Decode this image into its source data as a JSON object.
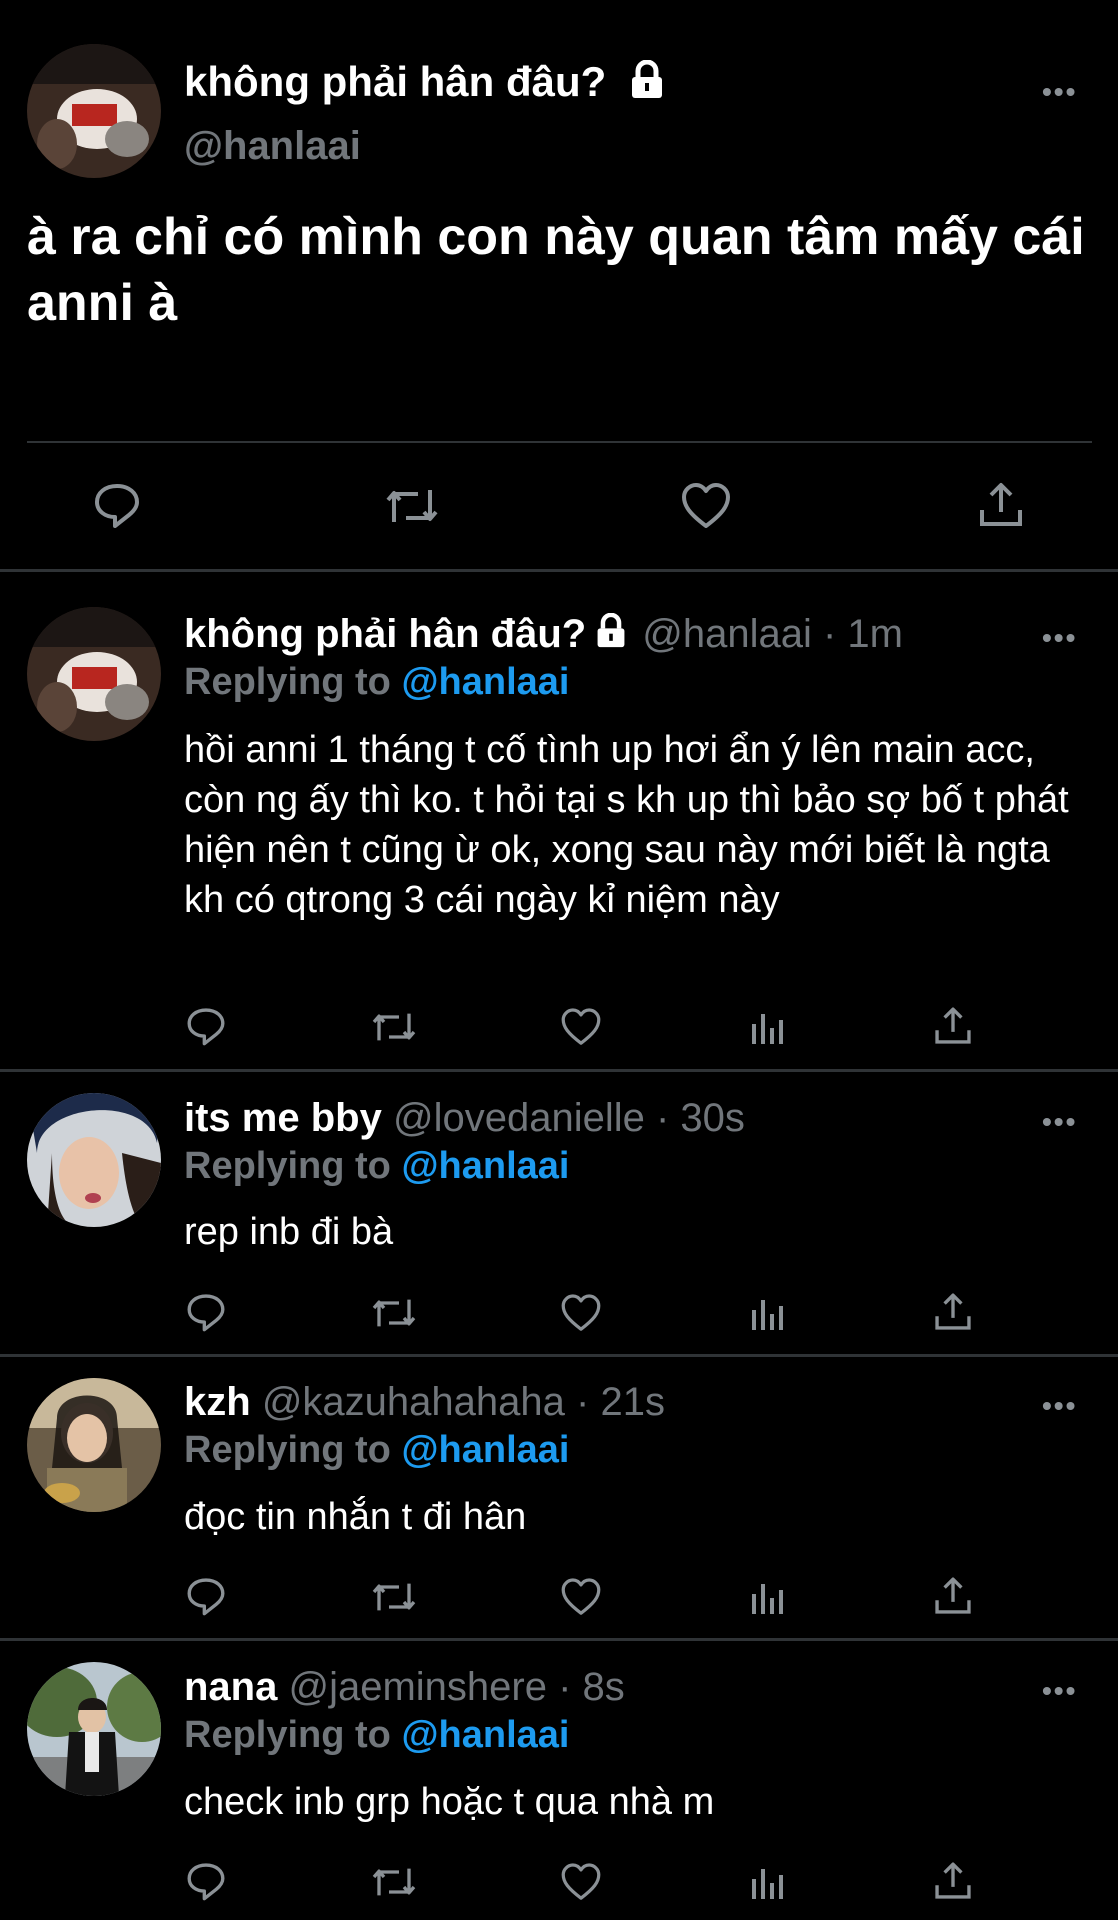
{
  "main_tweet": {
    "display_name": "không phải hân đâu?",
    "handle": "@hanlaai",
    "text": "à ra chỉ có mình con này quan tâm mấy cái anni à"
  },
  "replies": [
    {
      "display_name": "không phải hân đâu?",
      "handle": "@hanlaai",
      "time": "· 1m",
      "replying_label": "Replying to",
      "replying_to": "@hanlaai",
      "text": "hồi anni 1 tháng t cố tình up hơi ẩn ý lên main acc, còn ng ấy thì ko. t hỏi tại s kh up thì bảo sợ bố t phát hiện nên t cũng ừ ok, xong sau này mới biết là ngta kh có qtrong 3 cái ngày kỉ niệm này"
    },
    {
      "display_name": "its me bby",
      "handle": "@lovedanielle",
      "time": "· 30s",
      "replying_label": "Replying to",
      "replying_to": "@hanlaai",
      "text": "rep inb đi bà"
    },
    {
      "display_name": "kzh",
      "handle": "@kazuhahahaha",
      "time": "· 21s",
      "replying_label": "Replying to",
      "replying_to": "@hanlaai",
      "text": "đọc tin nhắn t đi hân"
    },
    {
      "display_name": "nana",
      "handle": "@jaeminshere",
      "time": "· 8s",
      "replying_label": "Replying to",
      "replying_to": "@hanlaai",
      "text": "check inb grp hoặc t qua nhà m"
    }
  ],
  "more_label": "•••",
  "icons": [
    "reply-icon",
    "retweet-icon",
    "like-icon",
    "analytics-icon",
    "share-icon",
    "lock-icon",
    "more-icon"
  ],
  "colors": {
    "background": "#000000",
    "muted": "#71767b",
    "mention": "#1d9bf0",
    "divider": "#2f3336"
  }
}
